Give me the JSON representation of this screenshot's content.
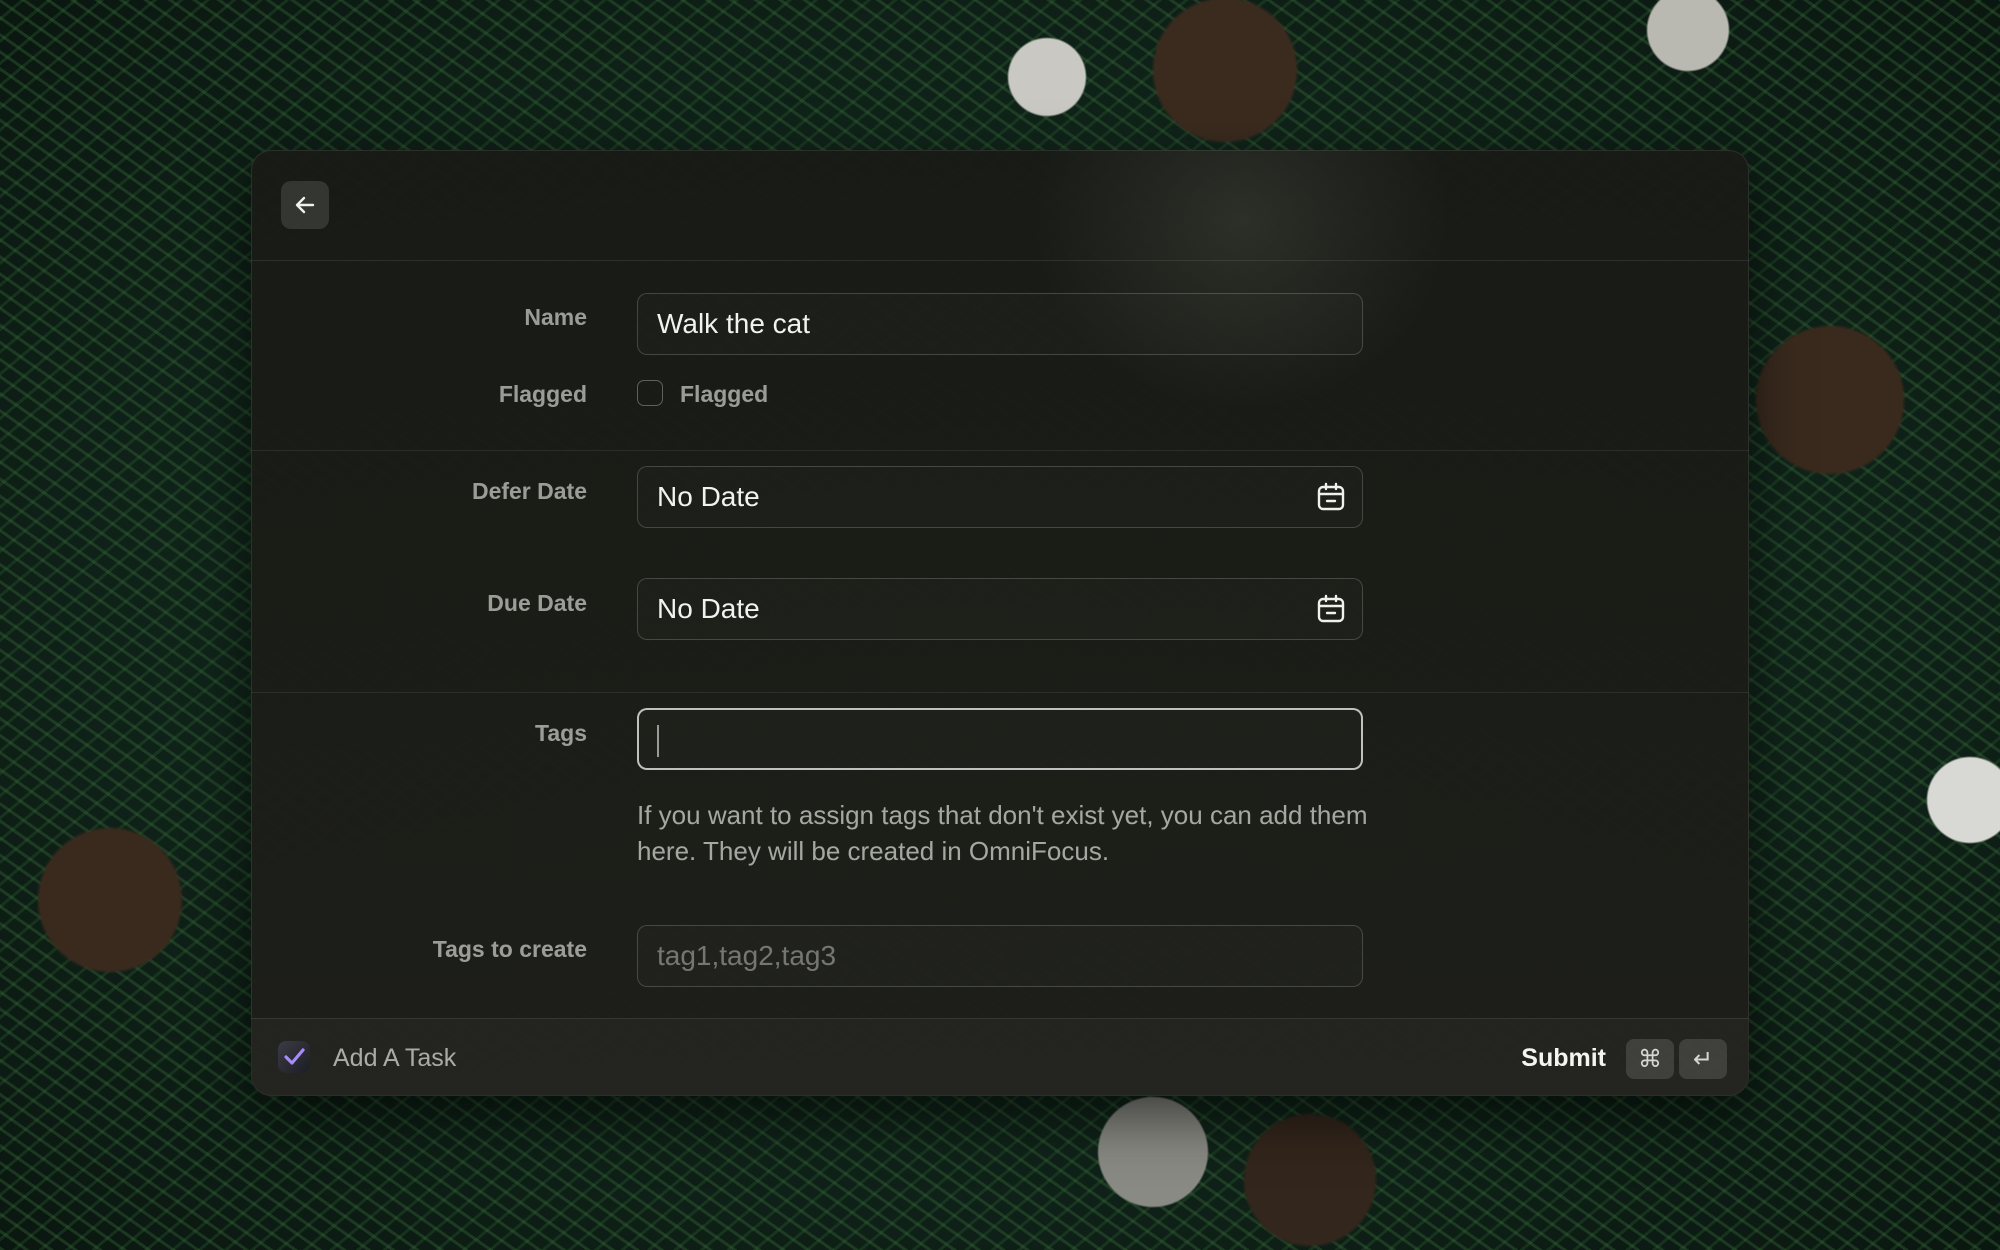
{
  "header": {
    "back_icon": "arrow-left-icon"
  },
  "form": {
    "name": {
      "label": "Name",
      "value": "Walk the cat"
    },
    "flagged": {
      "label": "Flagged",
      "checkbox_label": "Flagged",
      "checked": false
    },
    "defer_date": {
      "label": "Defer Date",
      "value": "No Date",
      "icon": "calendar-icon"
    },
    "due_date": {
      "label": "Due Date",
      "value": "No Date",
      "icon": "calendar-icon"
    },
    "tags": {
      "label": "Tags",
      "value": ""
    },
    "tags_help": "If you want to assign tags that don't exist yet, you can add them here. They will be created in OmniFocus.",
    "tags_to_create": {
      "label": "Tags to create",
      "placeholder": "tag1,tag2,tag3"
    }
  },
  "footer": {
    "app_icon": "checkmark-icon",
    "title": "Add A Task",
    "submit_label": "Submit",
    "shortcut_keys": [
      "⌘",
      "↵"
    ]
  },
  "colors": {
    "accent": "#8b5cf6"
  }
}
